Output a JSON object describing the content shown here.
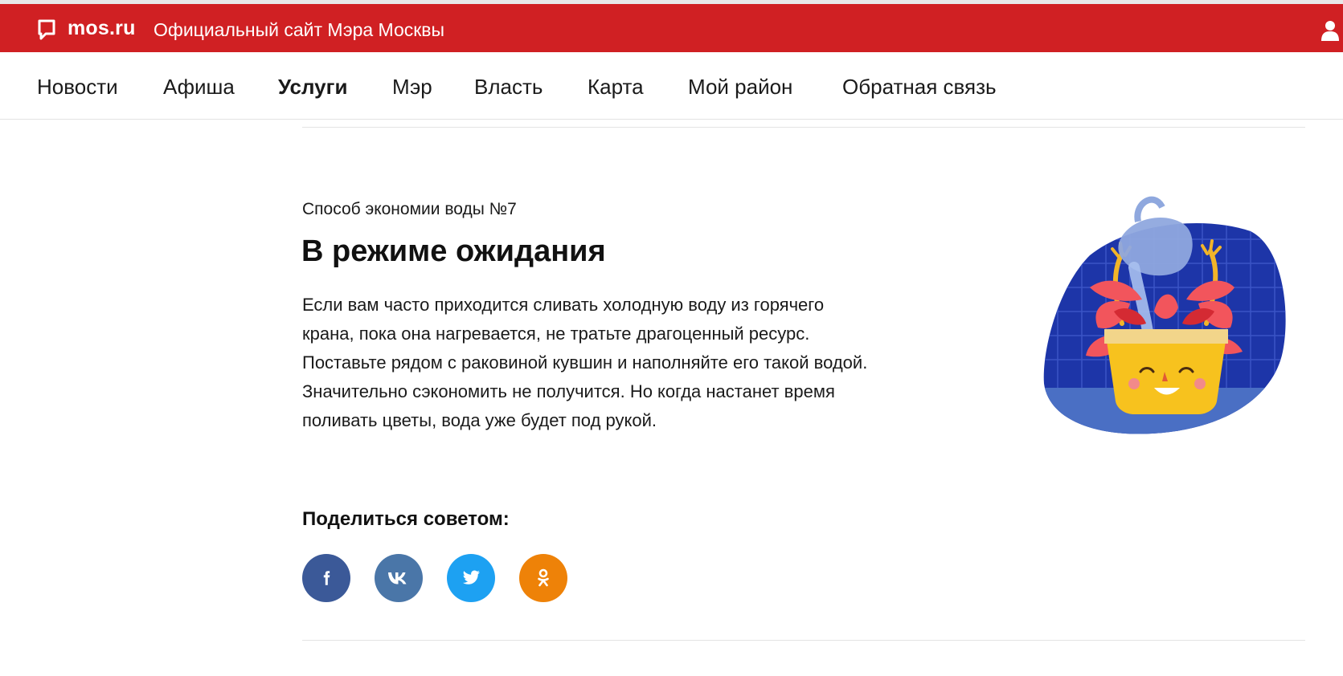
{
  "header": {
    "brand": "mos.ru",
    "site_title": "Официальный сайт Мэра Москвы",
    "color": "#d02023"
  },
  "nav": {
    "items": [
      {
        "label": "Новости",
        "active": false
      },
      {
        "label": "Афиша",
        "active": false
      },
      {
        "label": "Услуги",
        "active": true
      },
      {
        "label": "Мэр",
        "active": false
      },
      {
        "label": "Власть",
        "active": false
      },
      {
        "label": "Карта",
        "active": false
      },
      {
        "label": "Мой район",
        "active": false
      },
      {
        "label": "Обратная связь",
        "active": false
      }
    ]
  },
  "article": {
    "eyebrow": "Способ экономии воды №7",
    "title": "В режиме ожидания",
    "body_lines": [
      "Если вам часто приходится сливать холодную воду из горячего",
      "крана, пока она нагревается, не тратьте драгоценный ресурс.",
      "Поставьте рядом с раковиной кувшин и наполняйте его такой водой.",
      "Значительно сэкономить не получится. Но когда настанет время",
      "поливать цветы, вода уже будет под рукой."
    ]
  },
  "share": {
    "title": "Поделиться советом:",
    "buttons": [
      {
        "network": "facebook",
        "icon": "facebook-icon",
        "color": "#3b5998"
      },
      {
        "network": "vkontakte",
        "icon": "vk-icon",
        "color": "#4a76a8"
      },
      {
        "network": "twitter",
        "icon": "twitter-icon",
        "color": "#1da1f2"
      },
      {
        "network": "odnoklassniki",
        "icon": "ok-icon",
        "color": "#ee8208"
      }
    ]
  }
}
